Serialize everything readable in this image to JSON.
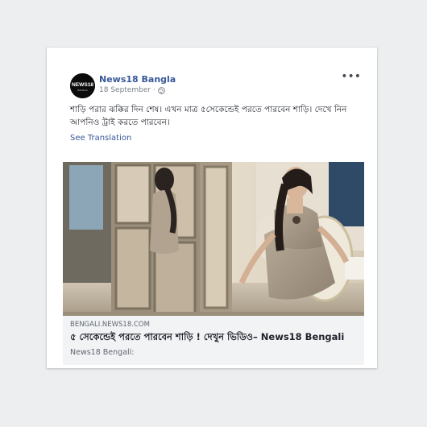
{
  "post": {
    "page_name": "News18 Bangla",
    "date": "18 September ·",
    "avatar_text": "NEWS18",
    "avatar_sub": "BANGLA",
    "more_label": "•••",
    "text": "শাড়ি পরার ঝক্কির দিন শেষ। এখন মাত্র ৫সেকেন্ডেই পরতে পারবেন শাড়ি। দেখে নিন আপনিও ট্রাই করতে পারবেন।",
    "see_translation": "See Translation"
  },
  "link_card": {
    "domain": "BENGALI.NEWS18.COM",
    "headline": "৫ সেকেন্ডেই পরতে পারবেন শাড়ি ! দেখুন ভিডিও– News18 Bengali",
    "description": "News18 Bengali:"
  },
  "icons": {
    "privacy": "globe-icon",
    "menu": "more-options-icon"
  },
  "colors": {
    "link": "#385898",
    "text": "#1d2129",
    "meta": "#7a7f87",
    "card_bg": "#f2f3f5"
  }
}
